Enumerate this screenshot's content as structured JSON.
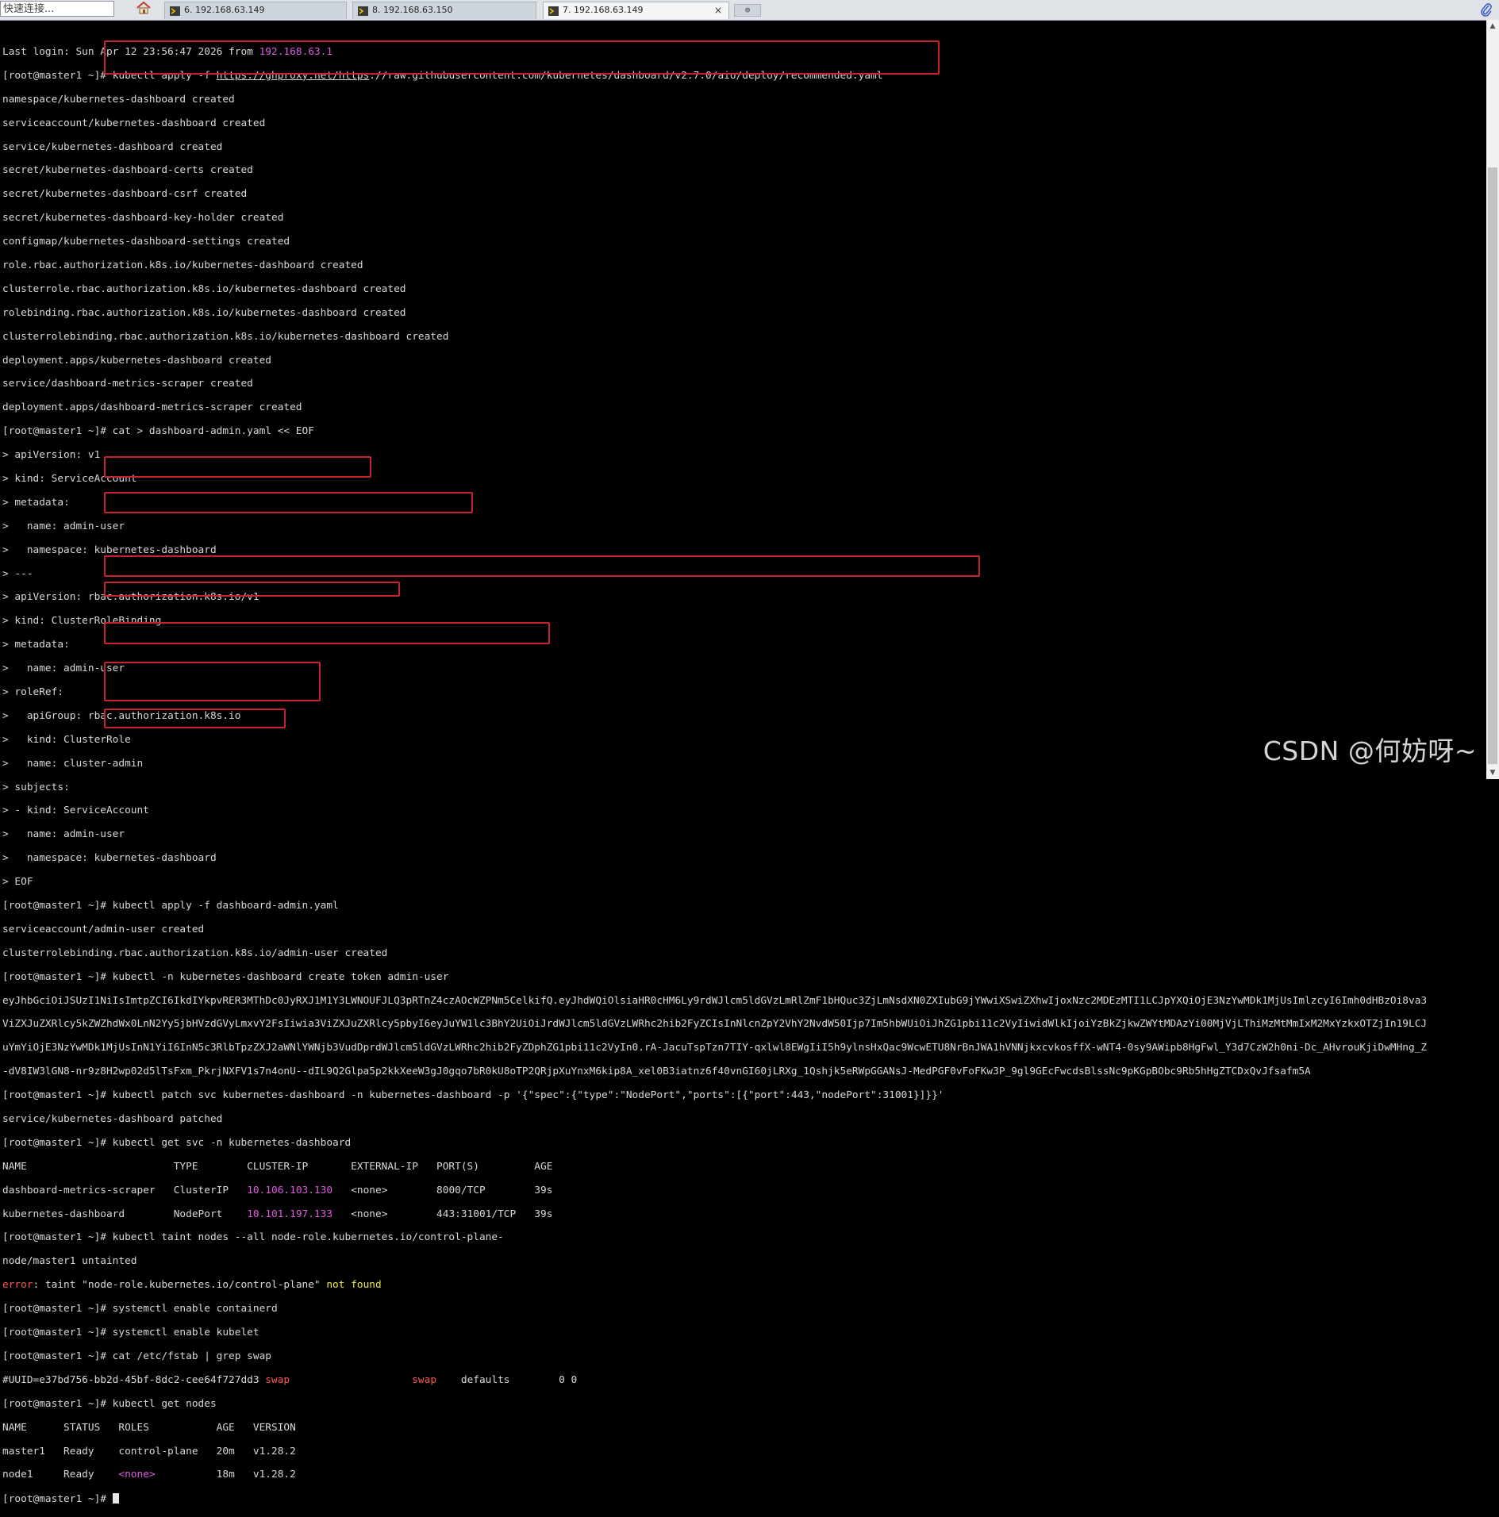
{
  "tabbar": {
    "quick_connect_placeholder": "快速连接...",
    "tabs": [
      {
        "label": "6. 192.168.63.149",
        "active": false
      },
      {
        "label": "8. 192.168.63.150",
        "active": false
      },
      {
        "label": "7. 192.168.63.149",
        "active": true
      }
    ],
    "close_glyph": "×",
    "new_tab_glyph": "⊕"
  },
  "terminal": {
    "l1": {
      "prefix": "Last login: Sun Apr 12 23:56:47 2026 from ",
      "ip": "192.168.63.1"
    },
    "l2": {
      "prompt": "[root@master1 ~]# ",
      "cmd": "kubectl apply -f ",
      "url": "https://ghproxy.net/https",
      "rest": "://raw.githubusercontent.com/kubernetes/dashboard/v2.7.0/aio/deploy/recommended.yaml"
    },
    "l3": "namespace/kubernetes-dashboard created",
    "l4": "serviceaccount/kubernetes-dashboard created",
    "l5": "service/kubernetes-dashboard created",
    "l6": "secret/kubernetes-dashboard-certs created",
    "l7": "secret/kubernetes-dashboard-csrf created",
    "l8": "secret/kubernetes-dashboard-key-holder created",
    "l9": "configmap/kubernetes-dashboard-settings created",
    "l10": "role.rbac.authorization.k8s.io/kubernetes-dashboard created",
    "l11": "clusterrole.rbac.authorization.k8s.io/kubernetes-dashboard created",
    "l12": "rolebinding.rbac.authorization.k8s.io/kubernetes-dashboard created",
    "l13": "clusterrolebinding.rbac.authorization.k8s.io/kubernetes-dashboard created",
    "l14": "deployment.apps/kubernetes-dashboard created",
    "l15": "service/dashboard-metrics-scraper created",
    "l16": "deployment.apps/dashboard-metrics-scraper created",
    "l17": "[root@master1 ~]# cat > dashboard-admin.yaml << EOF",
    "l18": "> apiVersion: v1",
    "l19": "> kind: ServiceAccount",
    "l20": "> metadata:",
    "l21": ">   name: admin-user",
    "l22": ">   namespace: kubernetes-dashboard",
    "l23": "> ---",
    "l24": "> apiVersion: rbac.authorization.k8s.io/v1",
    "l25": "> kind: ClusterRoleBinding",
    "l26": "> metadata:",
    "l27": ">   name: admin-user",
    "l28": "> roleRef:",
    "l29": ">   apiGroup: rbac.authorization.k8s.io",
    "l30": ">   kind: ClusterRole",
    "l31": ">   name: cluster-admin",
    "l32": "> subjects:",
    "l33": "> - kind: ServiceAccount",
    "l34": ">   name: admin-user",
    "l35": ">   namespace: kubernetes-dashboard",
    "l36": "> EOF",
    "l37": "[root@master1 ~]# kubectl apply -f dashboard-admin.yaml",
    "l38": "serviceaccount/admin-user created",
    "l39": "clusterrolebinding.rbac.authorization.k8s.io/admin-user created",
    "l40": "[root@master1 ~]# kubectl -n kubernetes-dashboard create token admin-user",
    "l41": "eyJhbGciOiJSUzI1NiIsImtpZCI6IkdIYkpvRER3MThDc0JyRXJ1M1Y3LWNOUFJLQ3pRTnZ4czAOcWZPNm5CelkifQ.eyJhdWQiOlsiaHR0cHM6Ly9rdWJlcm5ldGVzLmRlZmF1bHQuc3ZjLmNsdXN0ZXIubG9jYWwiXSwiZXhwIjoxNzc2MDEzMTI1LCJpYXQiOjE3NzYwMDk1MjUsImlzcyI6Imh0dHBzOi8va3",
    "l42": "ViZXJuZXRlcy5kZWZhdWx0LnN2Yy5jbHVzdGVyLmxvY2FsIiwia3ViZXJuZXRlcy5pbyI6eyJuYW1lc3BhY2UiOiJrdWJlcm5ldGVzLWRhc2hib2FyZCIsInNlcnZpY2VhY2NvdW50Ijp7Im5hbWUiOiJhZG1pbi11c2VyIiwidWlkIjoiYzBkZjkwZWYtMDAzYi00MjVjLThiMzMtMmIxM2MxYzkxOTZjIn19LCJ",
    "l43": "uYmYiOjE3NzYwMDk1MjUsInN1YiI6InN5c3RlbTpzZXJ2aWNlYWNjb3VudDprdWJlcm5ldGVzLWRhc2hib2FyZDphZG1pbi11c2VyIn0.rA-JacuTspTzn7TIY-qxlwl8EWgIiI5h9ylnsHxQac9WcwETU8NrBnJWA1hVNNjkxcvkosffX-wNT4-0sy9AWipb8HgFwl_Y3d7CzW2h0ni-Dc_AHvrouKjiDwMHng_Z",
    "l44": "-dV8IW3lGN8-nr9z8H2wp02d5lTsFxm_PkrjNXFV1s7n4onU--dIL9Q2Glpa5p2kkXeeW3gJ0gqo7bR0kU8oTP2QRjpXuYnxM6kip8A_xel0B3iatnz6f40vnGI60jLRXg_1Qshjk5eRWpGGANsJ-MedPGF0vFoFKw3P_9gl9GEcFwcdsBlssNc9pKGpBObc9Rb5hHgZTCDxQvJfsafm5A",
    "l45": "[root@master1 ~]# kubectl patch svc kubernetes-dashboard -n kubernetes-dashboard -p '{\"spec\":{\"type\":\"NodePort\",\"ports\":[{\"port\":443,\"nodePort\":31001}]}}'",
    "l46": "service/kubernetes-dashboard patched",
    "l47": "[root@master1 ~]# kubectl get svc -n kubernetes-dashboard",
    "l48": "NAME                        TYPE        CLUSTER-IP       EXTERNAL-IP   PORT(S)         AGE",
    "l49": {
      "a": "dashboard-metrics-scraper   ClusterIP   ",
      "ip": "10.106.103.130",
      "b": "   ",
      "none": "<none>",
      "c": "        8000/TCP        39s"
    },
    "l50": {
      "a": "kubernetes-dashboard        NodePort    ",
      "ip": "10.101.197.133",
      "b": "   ",
      "none": "<none>",
      "c": "        443:31001/TCP   39s"
    },
    "l51": "[root@master1 ~]# kubectl taint nodes --all node-role.kubernetes.io/control-plane-",
    "l52": "node/master1 untainted",
    "l53": {
      "err": "error",
      "msg": ": taint \"node-role.kubernetes.io/control-plane\" ",
      "nf": "not found"
    },
    "l54": "[root@master1 ~]# systemctl enable containerd",
    "l55": "[root@master1 ~]# systemctl enable kubelet",
    "l56": "[root@master1 ~]# cat /etc/fstab | grep swap",
    "l57": {
      "a": "#UUID=e37bd756-bb2d-45bf-8dc2-cee64f727dd3 ",
      "swap1": "swap",
      "b": "                    ",
      "swap2": "swap",
      "c": "    defaults        0 0"
    },
    "l58": "[root@master1 ~]# kubectl get nodes",
    "l59": "NAME      STATUS   ROLES           AGE   VERSION",
    "l60": "master1   Ready    control-plane   20m   v1.28.2",
    "l61": {
      "a": "node1     Ready    ",
      "none": "<none>",
      "b": "          18m   v1.28.2"
    },
    "l62": "[root@master1 ~]# "
  },
  "watermark": "CSDN @何妨呀~"
}
